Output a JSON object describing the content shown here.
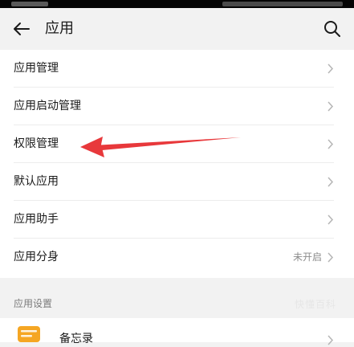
{
  "header": {
    "title": "应用"
  },
  "menu": [
    {
      "label": "应用管理",
      "value": ""
    },
    {
      "label": "应用启动管理",
      "value": ""
    },
    {
      "label": "权限管理",
      "value": ""
    },
    {
      "label": "默认应用",
      "value": ""
    },
    {
      "label": "应用助手",
      "value": ""
    },
    {
      "label": "应用分身",
      "value": "未开启"
    }
  ],
  "section": {
    "title": "应用设置",
    "items": [
      {
        "label": "备忘录"
      }
    ]
  },
  "watermark": "快懂百科",
  "colors": {
    "annotation_arrow": "#e8383b",
    "memo_icon": "#f5a623"
  },
  "icons": [
    "back-arrow-icon",
    "search-icon",
    "chevron-right-icon",
    "memo-app-icon"
  ]
}
